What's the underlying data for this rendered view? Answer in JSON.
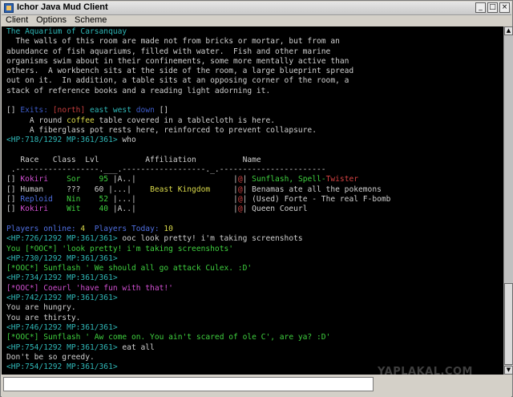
{
  "window": {
    "title": "Ichor Java Mud Client",
    "buttons": [
      "_",
      "□",
      "×"
    ]
  },
  "menu": [
    "Client",
    "Options",
    "Scheme"
  ],
  "colors": {
    "background": "#000000",
    "default": "#cfcfcf",
    "title": "#2fb7b7",
    "prompt": "#2fb7b7",
    "exit": "#c23c3c",
    "exit_dir": "#2fb7b7",
    "exit_down": "#3d5cc9",
    "yellow": "#d8d84a",
    "green": "#3fd03f",
    "magenta": "#d14fd1",
    "red": "#d44242",
    "blue": "#4f6fe0"
  },
  "terminal": [
    [
      {
        "t": "The Aquarium of Carsanquay",
        "c": "title"
      }
    ],
    [
      {
        "t": "  The walls of this room are made not from bricks or mortar, but from an"
      }
    ],
    [
      {
        "t": "abundance of fish aquariums, filled with water.  Fish and other marine"
      }
    ],
    [
      {
        "t": "organisms swim about in their confinements, some more mentally active than"
      }
    ],
    [
      {
        "t": "others.  A workbench sits at the side of the room, a large blueprint spread"
      }
    ],
    [
      {
        "t": "out on it.  In addition, a table sits at an opposing corner of the room, a"
      }
    ],
    [
      {
        "t": "stack of reference books and a reading light adorning it."
      }
    ],
    [
      {
        "t": ""
      }
    ],
    [
      {
        "t": "[] "
      },
      {
        "t": "Exits: ",
        "c": "exit_down"
      },
      {
        "t": "[",
        "c": "exit"
      },
      {
        "t": "north",
        "c": "exit"
      },
      {
        "t": "] ",
        "c": "exit"
      },
      {
        "t": "east west ",
        "c": "exit_dir"
      },
      {
        "t": "down",
        "c": "exit_down"
      },
      {
        "t": " []"
      }
    ],
    [
      {
        "t": "     A round "
      },
      {
        "t": "coffee",
        "c": "yellow"
      },
      {
        "t": " table covered in a tablecloth is here."
      }
    ],
    [
      {
        "t": "     A fiberglass pot rests here, reinforced to prevent collapsure."
      }
    ],
    [
      {
        "t": "<HP:718/1292 MP:361/361>",
        "c": "prompt"
      },
      {
        "t": " who"
      }
    ],
    [
      {
        "t": ""
      }
    ],
    [
      {
        "t": "   Race   Class  Lvl          Affiliation          Name"
      }
    ],
    [
      {
        "t": " .------------------.___.------------------._.-----------------------"
      }
    ],
    [
      {
        "t": "[] "
      },
      {
        "t": "Kokiri",
        "c": "magenta"
      },
      {
        "t": "    "
      },
      {
        "t": "Sor",
        "c": "green"
      },
      {
        "t": "    "
      },
      {
        "t": "95",
        "c": "green"
      },
      {
        "t": " |A..|                     |"
      },
      {
        "t": "@",
        "c": "red"
      },
      {
        "t": "| "
      },
      {
        "t": "Sunflash, ",
        "c": "green"
      },
      {
        "t": "Spell-",
        "c": "green"
      },
      {
        "t": "Twister",
        "c": "red"
      }
    ],
    [
      {
        "t": "[] Human     ???   60 |...|    "
      },
      {
        "t": "Beast Kingdom",
        "c": "yellow"
      },
      {
        "t": "     |"
      },
      {
        "t": "@",
        "c": "red"
      },
      {
        "t": "| Benamas ate all the pokemons"
      }
    ],
    [
      {
        "t": "[] "
      },
      {
        "t": "Reploid",
        "c": "blue"
      },
      {
        "t": "   "
      },
      {
        "t": "Nin",
        "c": "green"
      },
      {
        "t": "    "
      },
      {
        "t": "52",
        "c": "green"
      },
      {
        "t": " |...|                     |"
      },
      {
        "t": "@",
        "c": "red"
      },
      {
        "t": "| (Used) Forte - The real F-bomb"
      }
    ],
    [
      {
        "t": "[] "
      },
      {
        "t": "Kokiri",
        "c": "magenta"
      },
      {
        "t": "    "
      },
      {
        "t": "Wit",
        "c": "green"
      },
      {
        "t": "    "
      },
      {
        "t": "40",
        "c": "green"
      },
      {
        "t": " |A..|                     |"
      },
      {
        "t": "@",
        "c": "red"
      },
      {
        "t": "| Queen Coeurl"
      }
    ],
    [
      {
        "t": ""
      }
    ],
    [
      {
        "t": "Players online: ",
        "c": "blue"
      },
      {
        "t": "4",
        "c": "yellow"
      },
      {
        "t": "  Players Today: ",
        "c": "blue"
      },
      {
        "t": "10",
        "c": "yellow"
      }
    ],
    [
      {
        "t": "<HP:726/1292 MP:361/361>",
        "c": "prompt"
      },
      {
        "t": " ooc look pretty! i'm taking screenshots"
      }
    ],
    [
      {
        "t": "You [*OOC*] 'look pretty! i'm taking screenshots'",
        "c": "green"
      }
    ],
    [
      {
        "t": "<HP:730/1292 MP:361/361>",
        "c": "prompt"
      }
    ],
    [
      {
        "t": "[*OOC*] Sunflash ' We should all go attack Culex. :D'",
        "c": "green"
      }
    ],
    [
      {
        "t": "<HP:734/1292 MP:361/361>",
        "c": "prompt"
      }
    ],
    [
      {
        "t": "[*OOC*] Coeurl 'have fun with that!'",
        "c": "magenta"
      }
    ],
    [
      {
        "t": "<HP:742/1292 MP:361/361>",
        "c": "prompt"
      }
    ],
    [
      {
        "t": "You are hungry."
      }
    ],
    [
      {
        "t": "You are thirsty."
      }
    ],
    [
      {
        "t": "<HP:746/1292 MP:361/361>",
        "c": "prompt"
      }
    ],
    [
      {
        "t": "[*OOC*] Sunflash ' Aw come on. You ain't scared of ole C', are ya? :D'",
        "c": "green"
      }
    ],
    [
      {
        "t": "<HP:754/1292 MP:361/361>",
        "c": "prompt"
      },
      {
        "t": " eat all"
      }
    ],
    [
      {
        "t": "Don't be so greedy."
      }
    ],
    [
      {
        "t": "<HP:754/1292 MP:361/361>",
        "c": "prompt"
      }
    ]
  ],
  "input": {
    "value": ""
  },
  "watermark": "YAPLAKAL.COM"
}
